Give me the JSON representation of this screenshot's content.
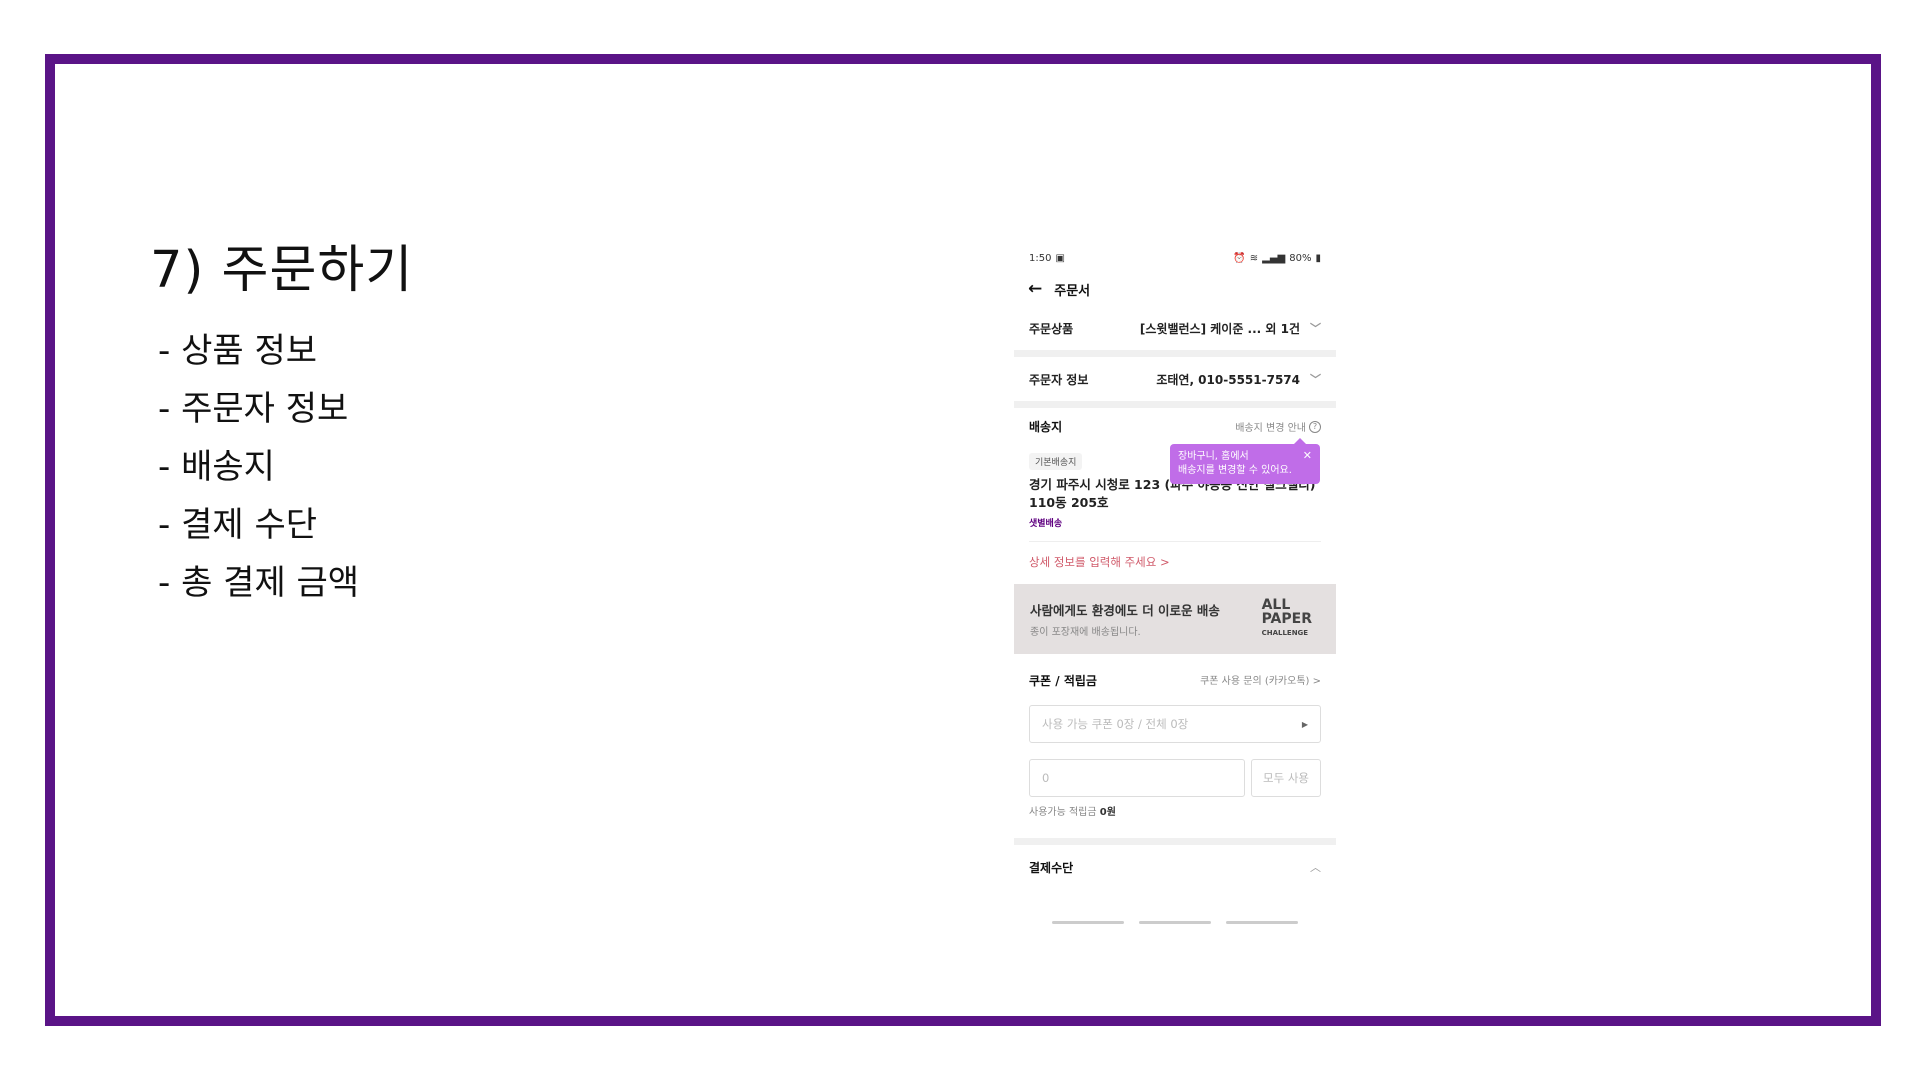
{
  "slide": {
    "title": "7)  주문하기",
    "bullets": [
      "- 상품 정보",
      "- 주문자 정보",
      "- 배송지",
      "- 결제 수단",
      "- 총 결제 금액"
    ],
    "frame_color": "#5a1487"
  },
  "phone": {
    "status": {
      "time": "1:50",
      "battery": "80%"
    },
    "appbar": {
      "title": "주문서"
    },
    "order_items": {
      "label": "주문상품",
      "value": "[스윗밸런스] 케이준 ...  외 1건"
    },
    "orderer": {
      "label": "주문자 정보",
      "value": "조태연, 010-5551-7574"
    },
    "shipping": {
      "label": "배송지",
      "guide": "배송지 변경 안내",
      "badge": "기본배송지",
      "address_line1": "경기 파주시 시청로 123 (파주 야동동 신안 실크밸리)",
      "address_line2": "110동 205호",
      "delivery_type": "샛별배송",
      "detail_link": "상세 정보를 입력해 주세요 >",
      "tooltip_line1": "장바구니, 홈에서",
      "tooltip_line2": "배송지를 변경할 수 있어요."
    },
    "banner": {
      "title": "사람에게도 환경에도 더 이로운 배송",
      "subtitle": "종이 포장재에 배송됩니다.",
      "logo_line1": "ALL",
      "logo_line2": "PAPER",
      "logo_line3": "CHALLENGE"
    },
    "coupon": {
      "label": "쿠폰 / 적립금",
      "link": "쿠폰 사용 문의 (카카오톡) >",
      "select_placeholder": "사용 가능 쿠폰 0장 / 전체 0장",
      "points_placeholder": "0",
      "use_all": "모두 사용",
      "available_label": "사용가능 적립금",
      "available_value": "0원"
    },
    "payment": {
      "label": "결제수단"
    },
    "accent_color": "#5f0080",
    "tooltip_color": "#c06de8"
  }
}
